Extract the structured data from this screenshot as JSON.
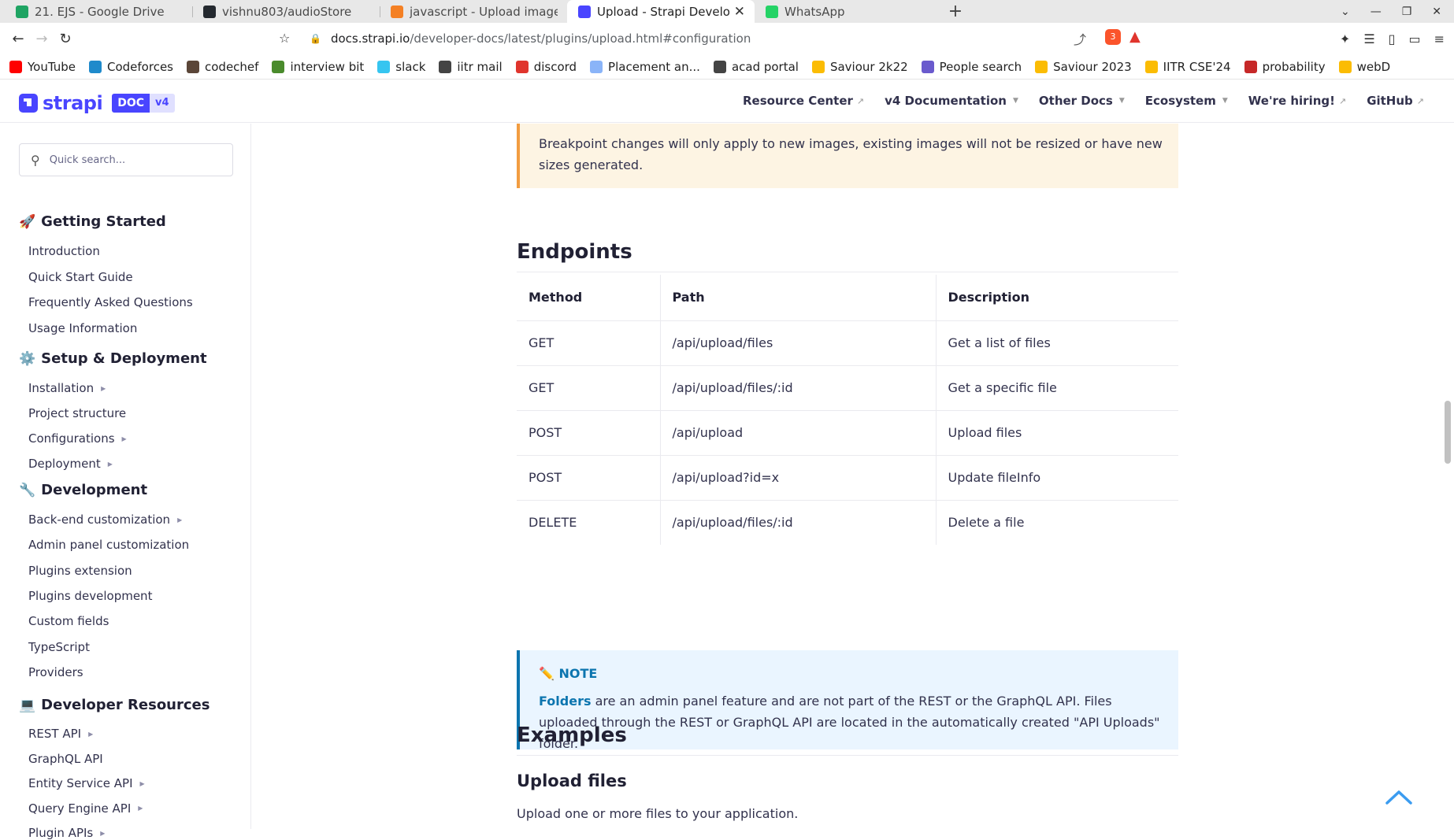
{
  "browser": {
    "tabs": [
      {
        "title": "21. EJS - Google Drive",
        "icon": "google-drive-icon",
        "color": "#1fa463"
      },
      {
        "title": "vishnu803/audioStore",
        "icon": "github-icon",
        "color": "#24292f"
      },
      {
        "title": "javascript - Upload image to st",
        "icon": "stackoverflow-icon",
        "color": "#f48024"
      },
      {
        "title": "Upload - Strapi Developer",
        "icon": "strapi-icon",
        "color": "#4945ff",
        "active": true
      },
      {
        "title": "WhatsApp",
        "icon": "whatsapp-icon",
        "color": "#25d366"
      }
    ],
    "url_host": "docs.strapi.io",
    "url_rest": "/developer-docs/latest/plugins/upload.html#configuration",
    "brave_shield_count": "3",
    "rewards_count": "1",
    "bookmarks": [
      {
        "label": "YouTube",
        "icon": "youtube-icon",
        "color": "#ff0000"
      },
      {
        "label": "Codeforces",
        "icon": "codeforces-icon",
        "color": "#1f8acb"
      },
      {
        "label": "codechef",
        "icon": "codechef-icon",
        "color": "#5b4638"
      },
      {
        "label": "interview bit",
        "icon": "interviewbit-icon",
        "color": "#4a8b2c"
      },
      {
        "label": "slack",
        "icon": "slack-icon",
        "color": "#36c5f0"
      },
      {
        "label": "iitr mail",
        "icon": "globe-icon",
        "color": "#444444"
      },
      {
        "label": "discord",
        "icon": "discord-icon",
        "color": "#e0352d"
      },
      {
        "label": "Placement an...",
        "icon": "document-icon",
        "color": "#8ab4f8"
      },
      {
        "label": "acad portal",
        "icon": "globe-icon",
        "color": "#444444"
      },
      {
        "label": "Saviour 2k22",
        "icon": "google-drive-icon",
        "color": "#fbbc04"
      },
      {
        "label": "People search",
        "icon": "people-icon",
        "color": "#6a5acd"
      },
      {
        "label": "Saviour 2023",
        "icon": "google-drive-icon",
        "color": "#fbbc04"
      },
      {
        "label": "IITR CSE'24",
        "icon": "google-drive-icon",
        "color": "#fbbc04"
      },
      {
        "label": "probability",
        "icon": "probability-icon",
        "color": "#c62828"
      },
      {
        "label": "webD",
        "icon": "google-drive-icon",
        "color": "#fbbc04"
      }
    ]
  },
  "site": {
    "logo_text": "strapi",
    "badge_doc": "DOC",
    "badge_version": "v4",
    "nav": [
      {
        "label": "Resource Center",
        "external": true
      },
      {
        "label": "v4 Documentation",
        "dropdown": true
      },
      {
        "label": "Other Docs",
        "dropdown": true
      },
      {
        "label": "Ecosystem",
        "dropdown": true
      },
      {
        "label": "We're hiring!",
        "external": true
      },
      {
        "label": "GitHub",
        "external": true
      }
    ]
  },
  "sidebar": {
    "search_placeholder": "Quick search...",
    "sections": [
      {
        "title": "Getting Started",
        "emoji": "🚀",
        "items": [
          {
            "label": "Introduction"
          },
          {
            "label": "Quick Start Guide"
          },
          {
            "label": "Frequently Asked Questions"
          },
          {
            "label": "Usage Information"
          }
        ]
      },
      {
        "title": "Setup & Deployment",
        "emoji": "⚙️",
        "items": [
          {
            "label": "Installation",
            "caret": true
          },
          {
            "label": "Project structure"
          },
          {
            "label": "Configurations",
            "caret": true
          },
          {
            "label": "Deployment",
            "caret": true
          }
        ]
      },
      {
        "title": "Development",
        "emoji": "🔧",
        "items": [
          {
            "label": "Back-end customization",
            "caret": true
          },
          {
            "label": "Admin panel customization"
          },
          {
            "label": "Plugins extension"
          },
          {
            "label": "Plugins development"
          },
          {
            "label": "Custom fields"
          },
          {
            "label": "TypeScript"
          },
          {
            "label": "Providers"
          }
        ]
      },
      {
        "title": "Developer Resources",
        "emoji": "💻",
        "items": [
          {
            "label": "REST API",
            "caret": true
          },
          {
            "label": "GraphQL API"
          },
          {
            "label": "Entity Service API",
            "caret": true
          },
          {
            "label": "Query Engine API",
            "caret": true
          },
          {
            "label": "Plugin APIs",
            "caret": true
          }
        ]
      }
    ]
  },
  "content": {
    "warning_text": "Breakpoint changes will only apply to new images, existing images will not be resized or have new sizes generated.",
    "endpoints_heading": "Endpoints",
    "table_headers": [
      "Method",
      "Path",
      "Description"
    ],
    "table_rows": [
      [
        "GET",
        "/api/upload/files",
        "Get a list of files"
      ],
      [
        "GET",
        "/api/upload/files/:id",
        "Get a specific file"
      ],
      [
        "POST",
        "/api/upload",
        "Upload files"
      ],
      [
        "POST",
        "/api/upload?id=x",
        "Update fileInfo"
      ],
      [
        "DELETE",
        "/api/upload/files/:id",
        "Delete a file"
      ]
    ],
    "note_title": "NOTE",
    "note_emoji": "✏️",
    "note_link": "Folders",
    "note_text": " are an admin panel feature and are not part of the REST or the GraphQL API. Files uploaded through the REST or GraphQL API are located in the automatically created \"API Uploads\" folder.",
    "examples_heading": "Examples",
    "upload_heading": "Upload files",
    "upload_text": "Upload one or more files to your application."
  }
}
